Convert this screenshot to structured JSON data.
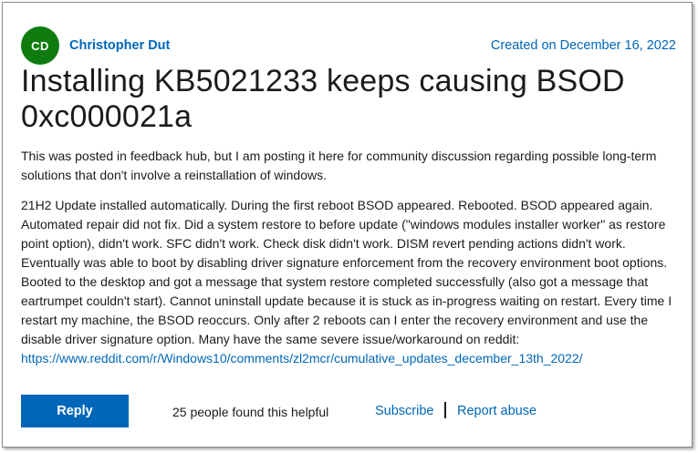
{
  "post": {
    "avatar_initials": "CD",
    "author": "Christopher Dut",
    "created": "Created on December 16, 2022",
    "title": "Installing KB5021233 keeps causing BSOD 0xc000021a",
    "paragraph_1": "This was posted in feedback hub, but I am posting it here for community discussion regarding possible long-term solutions that don't involve a reinstallation of windows.",
    "paragraph_2": "21H2 Update installed automatically. During the first reboot BSOD appeared. Rebooted. BSOD appeared again. Automated repair did not fix. Did a system restore to before update (\"windows modules installer worker\" as restore point option), didn't work. SFC didn't work. Check disk didn't work. DISM revert pending actions didn't work. Eventually was able to boot by disabling driver signature enforcement from the recovery environment boot options. Booted to the desktop and got a message that system restore completed successfully (also got a message that eartrumpet couldn't start). Cannot uninstall update because it is stuck as in-progress waiting on restart. Every time I restart my machine, the BSOD reoccurs. Only after 2 reboots can I enter the recovery environment and use the disable driver signature option. Many have the same severe issue/workaround on reddit: ",
    "link": "https://www.reddit.com/r/Windows10/comments/zl2mcr/cumulative_updates_december_13th_2022/"
  },
  "footer": {
    "reply_label": "Reply",
    "helpful_text": "25 people found this helpful",
    "subscribe_label": "Subscribe",
    "report_label": "Report abuse"
  },
  "colors": {
    "accent": "#0067b8",
    "avatar_bg": "#107c10",
    "text": "#1b1b1b"
  }
}
